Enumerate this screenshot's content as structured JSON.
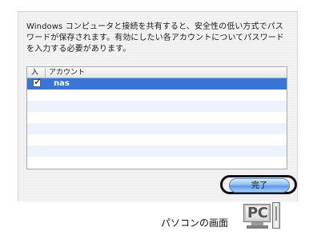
{
  "dialog": {
    "message": "Windows コンピュータと接続を共有すると、安全性の低い方式でパスワードが保存されます。有効にしたい各アカウントについてパスワードを入力する必要があります。"
  },
  "table": {
    "headers": {
      "enabled": "入",
      "account": "アカウント"
    },
    "rows": [
      {
        "checked": true,
        "checkmark": "✓",
        "account": "nas",
        "selected": true
      }
    ]
  },
  "actions": {
    "done_label": "完了"
  },
  "illustration": {
    "caption": "パソコンの画面",
    "icon_label": "PC"
  },
  "colors": {
    "selection": "#3875d7",
    "button_blue": "#5f97e5"
  },
  "icons": {
    "checkbox": "checked-checkbox",
    "computer": "pc-icon"
  }
}
